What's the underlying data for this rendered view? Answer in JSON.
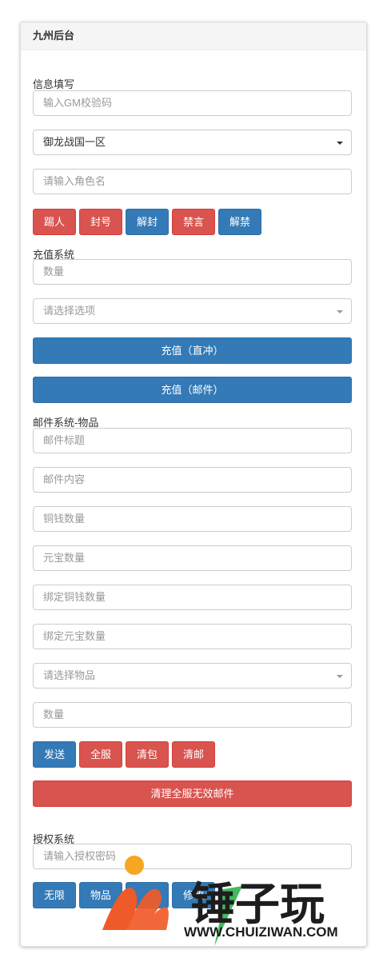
{
  "panel": {
    "title": "九州后台"
  },
  "info": {
    "label": "信息填写",
    "gm_code_placeholder": "输入GM校验码",
    "server_selected": "御龙战国一区",
    "role_placeholder": "请输入角色名",
    "buttons": [
      "踢人",
      "封号",
      "解封",
      "禁言",
      "解禁"
    ]
  },
  "recharge": {
    "label": "充值系统",
    "amount_placeholder": "数量",
    "option_placeholder": "请选择选项",
    "direct_button": "充值（直冲）",
    "mail_button": "充值（邮件）"
  },
  "mail": {
    "label": "邮件系统-物品",
    "title_placeholder": "邮件标题",
    "content_placeholder": "邮件内容",
    "copper_placeholder": "铜钱数量",
    "yuanbao_placeholder": "元宝数量",
    "bound_copper_placeholder": "绑定铜钱数量",
    "bound_yuanbao_placeholder": "绑定元宝数量",
    "item_placeholder": "请选择物品",
    "quantity_placeholder": "数量",
    "buttons": [
      "发送",
      "全服",
      "清包",
      "清邮"
    ],
    "clean_button": "清理全服无效邮件"
  },
  "auth": {
    "label": "授权系统",
    "password_placeholder": "请输入授权密码",
    "buttons": [
      "无限",
      "物品",
      "",
      "修改"
    ]
  },
  "watermark": {
    "brand": "锤子玩",
    "url": "WWW.CHUIZIWAN.COM"
  },
  "colors": {
    "danger": "#d9534f",
    "primary": "#337ab7",
    "watermark_orange": "#f05a28",
    "watermark_green": "#2bb24c"
  }
}
